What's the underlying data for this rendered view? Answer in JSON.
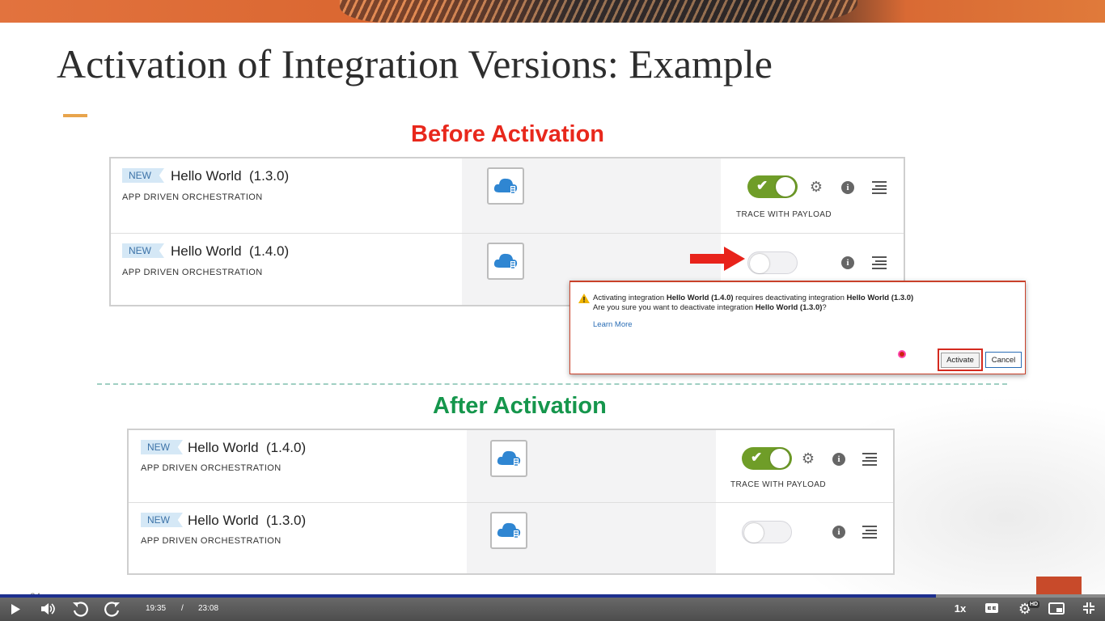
{
  "slide": {
    "title": "Activation of Integration Versions: Example",
    "before_label": "Before Activation",
    "after_label": "After Activation",
    "slide_number": "24"
  },
  "before": {
    "rows": [
      {
        "badge": "NEW",
        "name": "Hello World",
        "version": "(1.3.0)",
        "type": "APP DRIVEN ORCHESTRATION",
        "active": true,
        "trace_label": "TRACE WITH PAYLOAD"
      },
      {
        "badge": "NEW",
        "name": "Hello World",
        "version": "(1.4.0)",
        "type": "APP DRIVEN ORCHESTRATION",
        "active": false
      }
    ]
  },
  "dialog": {
    "line1_pre": "Activating integration ",
    "line1_bold1": "Hello World (1.4.0)",
    "line1_mid": " requires deactivating integration ",
    "line1_bold2": "Hello World (1.3.0)",
    "line2_pre": "Are you sure you want to deactivate integration ",
    "line2_bold": "Hello World (1.3.0)",
    "line2_post": "?",
    "learn_more": "Learn More",
    "activate_label": "Activate",
    "cancel_label": "Cancel"
  },
  "after": {
    "rows": [
      {
        "badge": "NEW",
        "name": "Hello World",
        "version": "(1.4.0)",
        "type": "APP DRIVEN ORCHESTRATION",
        "active": true,
        "trace_label": "TRACE WITH PAYLOAD"
      },
      {
        "badge": "NEW",
        "name": "Hello World",
        "version": "(1.3.0)",
        "type": "APP DRIVEN ORCHESTRATION",
        "active": false
      }
    ]
  },
  "player": {
    "current_time": "19:35",
    "separator": "/",
    "duration": "23:08",
    "speed": "1x",
    "quality_badge": "HD",
    "progress": 0.847
  },
  "colors": {
    "before_label": "#e8281c",
    "after_label": "#15964c",
    "toggle_on": "#6f9d28",
    "accent": "#e8a44c"
  }
}
